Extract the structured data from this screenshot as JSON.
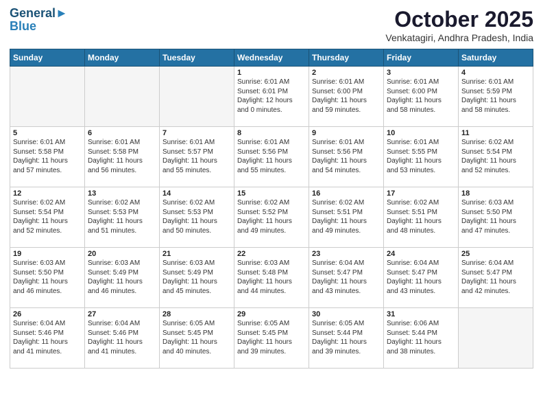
{
  "logo": {
    "line1": "General",
    "line2": "Blue"
  },
  "title": "October 2025",
  "location": "Venkatagiri, Andhra Pradesh, India",
  "days_header": [
    "Sunday",
    "Monday",
    "Tuesday",
    "Wednesday",
    "Thursday",
    "Friday",
    "Saturday"
  ],
  "weeks": [
    [
      {
        "day": "",
        "text": ""
      },
      {
        "day": "",
        "text": ""
      },
      {
        "day": "",
        "text": ""
      },
      {
        "day": "1",
        "text": "Sunrise: 6:01 AM\nSunset: 6:01 PM\nDaylight: 12 hours\nand 0 minutes."
      },
      {
        "day": "2",
        "text": "Sunrise: 6:01 AM\nSunset: 6:00 PM\nDaylight: 11 hours\nand 59 minutes."
      },
      {
        "day": "3",
        "text": "Sunrise: 6:01 AM\nSunset: 6:00 PM\nDaylight: 11 hours\nand 58 minutes."
      },
      {
        "day": "4",
        "text": "Sunrise: 6:01 AM\nSunset: 5:59 PM\nDaylight: 11 hours\nand 58 minutes."
      }
    ],
    [
      {
        "day": "5",
        "text": "Sunrise: 6:01 AM\nSunset: 5:58 PM\nDaylight: 11 hours\nand 57 minutes."
      },
      {
        "day": "6",
        "text": "Sunrise: 6:01 AM\nSunset: 5:58 PM\nDaylight: 11 hours\nand 56 minutes."
      },
      {
        "day": "7",
        "text": "Sunrise: 6:01 AM\nSunset: 5:57 PM\nDaylight: 11 hours\nand 55 minutes."
      },
      {
        "day": "8",
        "text": "Sunrise: 6:01 AM\nSunset: 5:56 PM\nDaylight: 11 hours\nand 55 minutes."
      },
      {
        "day": "9",
        "text": "Sunrise: 6:01 AM\nSunset: 5:56 PM\nDaylight: 11 hours\nand 54 minutes."
      },
      {
        "day": "10",
        "text": "Sunrise: 6:01 AM\nSunset: 5:55 PM\nDaylight: 11 hours\nand 53 minutes."
      },
      {
        "day": "11",
        "text": "Sunrise: 6:02 AM\nSunset: 5:54 PM\nDaylight: 11 hours\nand 52 minutes."
      }
    ],
    [
      {
        "day": "12",
        "text": "Sunrise: 6:02 AM\nSunset: 5:54 PM\nDaylight: 11 hours\nand 52 minutes."
      },
      {
        "day": "13",
        "text": "Sunrise: 6:02 AM\nSunset: 5:53 PM\nDaylight: 11 hours\nand 51 minutes."
      },
      {
        "day": "14",
        "text": "Sunrise: 6:02 AM\nSunset: 5:53 PM\nDaylight: 11 hours\nand 50 minutes."
      },
      {
        "day": "15",
        "text": "Sunrise: 6:02 AM\nSunset: 5:52 PM\nDaylight: 11 hours\nand 49 minutes."
      },
      {
        "day": "16",
        "text": "Sunrise: 6:02 AM\nSunset: 5:51 PM\nDaylight: 11 hours\nand 49 minutes."
      },
      {
        "day": "17",
        "text": "Sunrise: 6:02 AM\nSunset: 5:51 PM\nDaylight: 11 hours\nand 48 minutes."
      },
      {
        "day": "18",
        "text": "Sunrise: 6:03 AM\nSunset: 5:50 PM\nDaylight: 11 hours\nand 47 minutes."
      }
    ],
    [
      {
        "day": "19",
        "text": "Sunrise: 6:03 AM\nSunset: 5:50 PM\nDaylight: 11 hours\nand 46 minutes."
      },
      {
        "day": "20",
        "text": "Sunrise: 6:03 AM\nSunset: 5:49 PM\nDaylight: 11 hours\nand 46 minutes."
      },
      {
        "day": "21",
        "text": "Sunrise: 6:03 AM\nSunset: 5:49 PM\nDaylight: 11 hours\nand 45 minutes."
      },
      {
        "day": "22",
        "text": "Sunrise: 6:03 AM\nSunset: 5:48 PM\nDaylight: 11 hours\nand 44 minutes."
      },
      {
        "day": "23",
        "text": "Sunrise: 6:04 AM\nSunset: 5:47 PM\nDaylight: 11 hours\nand 43 minutes."
      },
      {
        "day": "24",
        "text": "Sunrise: 6:04 AM\nSunset: 5:47 PM\nDaylight: 11 hours\nand 43 minutes."
      },
      {
        "day": "25",
        "text": "Sunrise: 6:04 AM\nSunset: 5:47 PM\nDaylight: 11 hours\nand 42 minutes."
      }
    ],
    [
      {
        "day": "26",
        "text": "Sunrise: 6:04 AM\nSunset: 5:46 PM\nDaylight: 11 hours\nand 41 minutes."
      },
      {
        "day": "27",
        "text": "Sunrise: 6:04 AM\nSunset: 5:46 PM\nDaylight: 11 hours\nand 41 minutes."
      },
      {
        "day": "28",
        "text": "Sunrise: 6:05 AM\nSunset: 5:45 PM\nDaylight: 11 hours\nand 40 minutes."
      },
      {
        "day": "29",
        "text": "Sunrise: 6:05 AM\nSunset: 5:45 PM\nDaylight: 11 hours\nand 39 minutes."
      },
      {
        "day": "30",
        "text": "Sunrise: 6:05 AM\nSunset: 5:44 PM\nDaylight: 11 hours\nand 39 minutes."
      },
      {
        "day": "31",
        "text": "Sunrise: 6:06 AM\nSunset: 5:44 PM\nDaylight: 11 hours\nand 38 minutes."
      },
      {
        "day": "",
        "text": ""
      }
    ]
  ]
}
